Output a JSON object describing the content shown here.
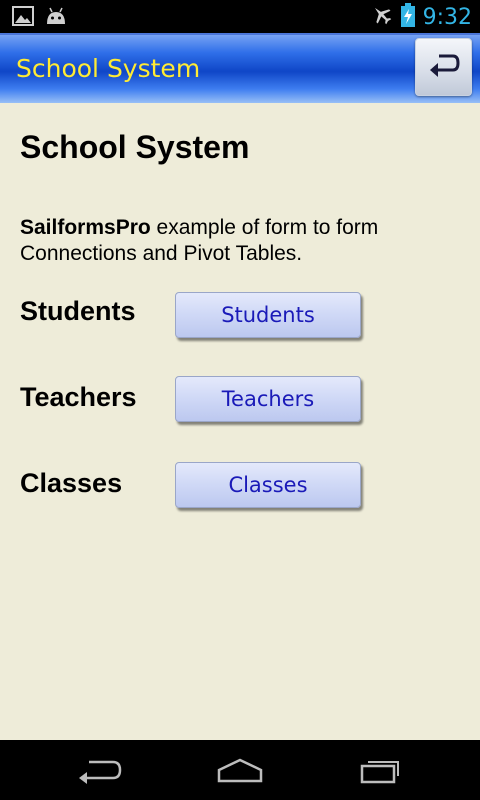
{
  "status_bar": {
    "time": "9:32",
    "icons": [
      "image-notification-icon",
      "android-notification-icon",
      "airplane-mode-icon",
      "battery-charging-icon"
    ]
  },
  "action_bar": {
    "title": "School System",
    "back_icon": "undo-icon"
  },
  "main": {
    "heading": "School System",
    "description_bold": "SailformsPro",
    "description_rest": " example of form to form Connections and Pivot Tables.",
    "rows": [
      {
        "label": "Students",
        "button": "Students"
      },
      {
        "label": "Teachers",
        "button": "Teachers"
      },
      {
        "label": "Classes",
        "button": "Classes"
      }
    ]
  },
  "nav_bar": {
    "icons": [
      "back-icon",
      "home-icon",
      "recent-apps-icon"
    ]
  }
}
